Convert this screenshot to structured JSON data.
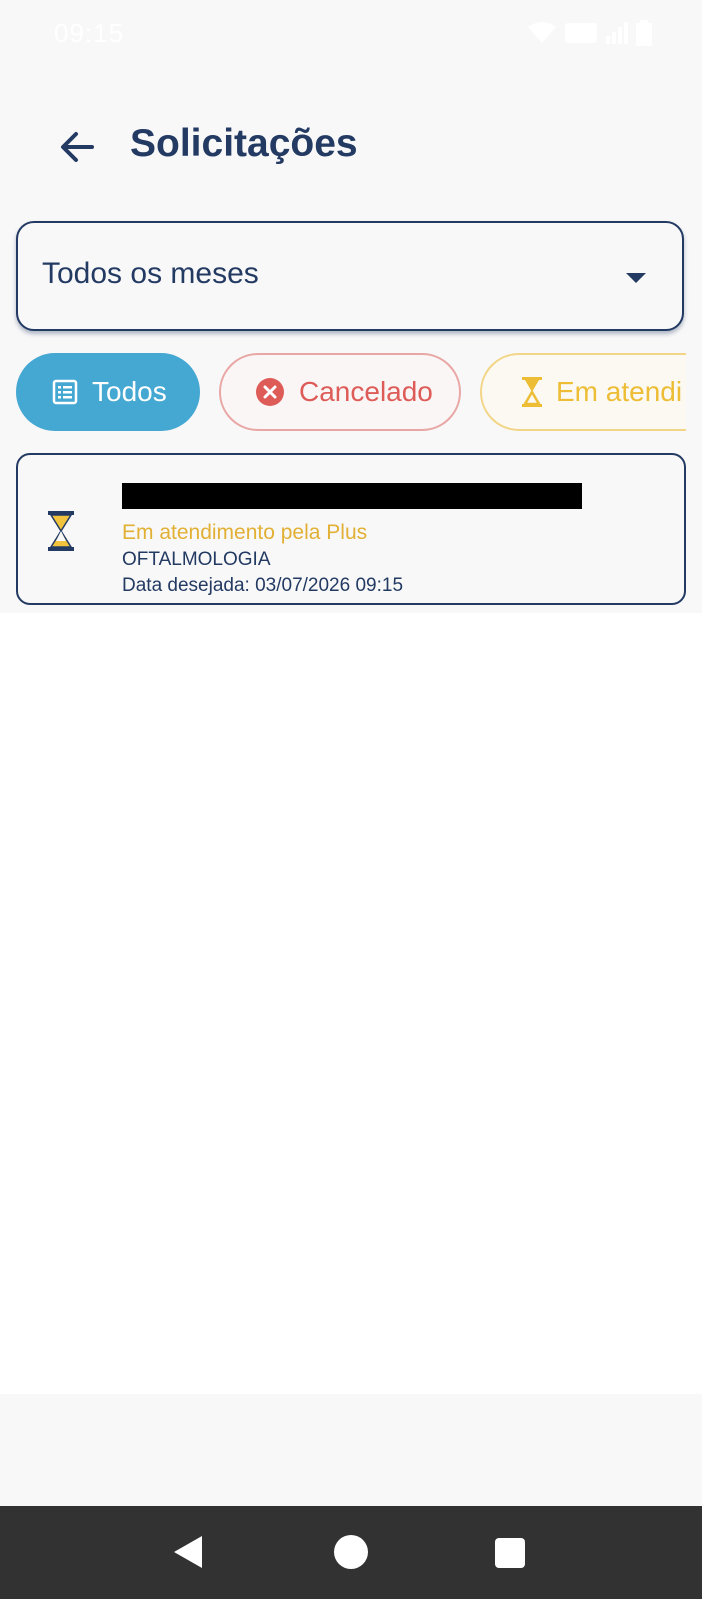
{
  "status_bar": {
    "time": "09:15"
  },
  "header": {
    "title": "Solicitações"
  },
  "month_filter": {
    "selected": "Todos os meses"
  },
  "filter_chips": [
    {
      "label": "Todos",
      "icon": "list-icon",
      "active": true
    },
    {
      "label": "Cancelado",
      "icon": "cancel-circle-icon",
      "active": false
    },
    {
      "label": "Em atendi",
      "icon": "hourglass-icon",
      "active": false
    }
  ],
  "requests": [
    {
      "name_redacted": true,
      "status": "Em atendimento pela Plus",
      "specialty": "OFTALMOLOGIA",
      "date": "Data desejada: 03/07/2026 09:15",
      "icon": "hourglass-icon"
    }
  ],
  "colors": {
    "primary": "#233a63",
    "chip_active": "#45a8d2",
    "cancel": "#dd5c58",
    "pending": "#edbd35"
  }
}
